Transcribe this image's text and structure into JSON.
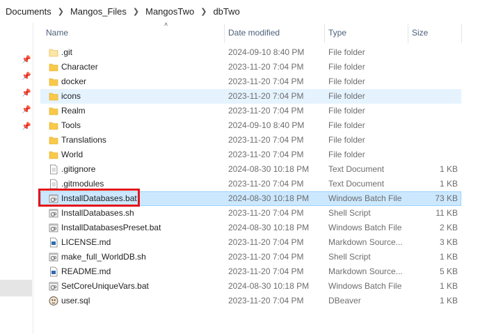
{
  "breadcrumb": [
    "Documents",
    "Mangos_Files",
    "MangosTwo",
    "dbTwo"
  ],
  "columns": {
    "name": "Name",
    "date": "Date modified",
    "type": "Type",
    "size": "Size"
  },
  "files": [
    {
      "name": ".git",
      "date": "2024-09-10 8:40 PM",
      "type": "File folder",
      "size": "",
      "icon": "folder-light-icon"
    },
    {
      "name": "Character",
      "date": "2023-11-20 7:04 PM",
      "type": "File folder",
      "size": "",
      "icon": "folder-icon"
    },
    {
      "name": "docker",
      "date": "2023-11-20 7:04 PM",
      "type": "File folder",
      "size": "",
      "icon": "folder-icon"
    },
    {
      "name": "icons",
      "date": "2023-11-20 7:04 PM",
      "type": "File folder",
      "size": "",
      "icon": "folder-icon"
    },
    {
      "name": "Realm",
      "date": "2023-11-20 7:04 PM",
      "type": "File folder",
      "size": "",
      "icon": "folder-icon"
    },
    {
      "name": "Tools",
      "date": "2024-09-10 8:40 PM",
      "type": "File folder",
      "size": "",
      "icon": "folder-icon"
    },
    {
      "name": "Translations",
      "date": "2023-11-20 7:04 PM",
      "type": "File folder",
      "size": "",
      "icon": "folder-icon"
    },
    {
      "name": "World",
      "date": "2023-11-20 7:04 PM",
      "type": "File folder",
      "size": "",
      "icon": "folder-icon"
    },
    {
      "name": ".gitignore",
      "date": "2024-08-30 10:18 PM",
      "type": "Text Document",
      "size": "1 KB",
      "icon": "text-file-icon"
    },
    {
      "name": ".gitmodules",
      "date": "2023-11-20 7:04 PM",
      "type": "Text Document",
      "size": "1 KB",
      "icon": "text-file-icon"
    },
    {
      "name": "InstallDatabases.bat",
      "date": "2024-08-30 10:18 PM",
      "type": "Windows Batch File",
      "size": "73 KB",
      "icon": "batch-file-icon"
    },
    {
      "name": "InstallDatabases.sh",
      "date": "2023-11-20 7:04 PM",
      "type": "Shell Script",
      "size": "11 KB",
      "icon": "batch-file-icon"
    },
    {
      "name": "InstallDatabasesPreset.bat",
      "date": "2024-08-30 10:18 PM",
      "type": "Windows Batch File",
      "size": "2 KB",
      "icon": "batch-file-icon"
    },
    {
      "name": "LICENSE.md",
      "date": "2023-11-20 7:04 PM",
      "type": "Markdown Source...",
      "size": "3 KB",
      "icon": "markdown-file-icon"
    },
    {
      "name": "make_full_WorldDB.sh",
      "date": "2023-11-20 7:04 PM",
      "type": "Shell Script",
      "size": "1 KB",
      "icon": "batch-file-icon"
    },
    {
      "name": "README.md",
      "date": "2023-11-20 7:04 PM",
      "type": "Markdown Source...",
      "size": "5 KB",
      "icon": "markdown-file-icon"
    },
    {
      "name": "SetCoreUniqueVars.bat",
      "date": "2024-08-30 10:18 PM",
      "type": "Windows Batch File",
      "size": "1 KB",
      "icon": "batch-file-icon"
    },
    {
      "name": "user.sql",
      "date": "2023-11-20 7:04 PM",
      "type": "DBeaver",
      "size": "1 KB",
      "icon": "dbeaver-file-icon"
    }
  ],
  "hover_row": "icons",
  "selected_row": "InstallDatabases.bat",
  "colors": {
    "folder": "#f8c94a",
    "selection": "#cce8ff",
    "hover": "#e5f3ff",
    "highlight": "#e3141b",
    "header_text": "#4c607a"
  }
}
